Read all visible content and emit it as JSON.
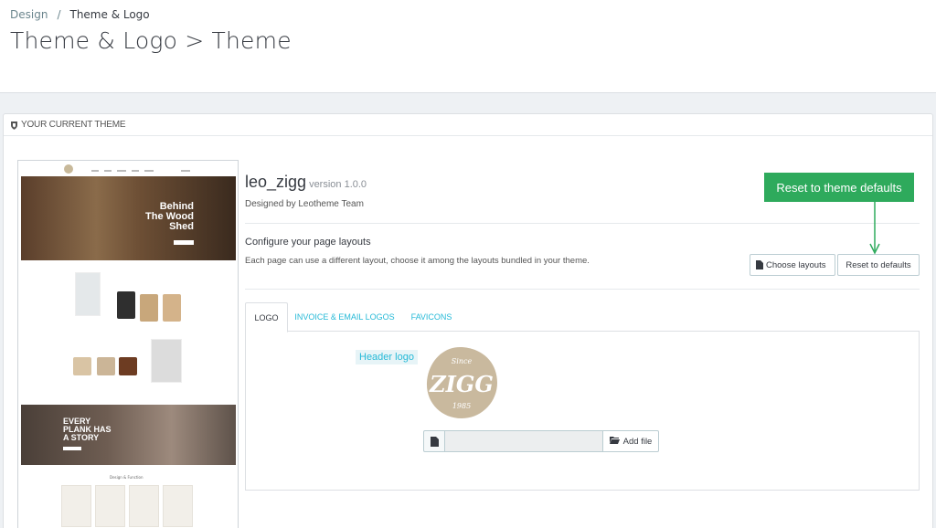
{
  "breadcrumb": {
    "parent": "Design",
    "separator": "/",
    "current": "Theme & Logo"
  },
  "page_title": "Theme & Logo > Theme",
  "panel": {
    "heading": "Your current theme",
    "icon": "shield-icon"
  },
  "preview": {
    "hero1_line1": "Behind",
    "hero1_line2": "The Wood",
    "hero1_line3": "Shed",
    "hero2_line1": "EVERY",
    "hero2_line2": "PLANK HAS",
    "hero2_line3": "A STORY",
    "caption": "Design & Function"
  },
  "theme": {
    "name": "leo_zigg",
    "version": "version 1.0.0",
    "designer": "Designed by Leotheme Team"
  },
  "layouts": {
    "title": "Configure your page layouts",
    "description": "Each page can use a different layout, choose it among the layouts bundled in your theme."
  },
  "buttons": {
    "choose_layouts": "Choose layouts",
    "reset_defaults": "Reset to defaults",
    "add_file": "Add file"
  },
  "tooltip": "Reset to theme defaults",
  "tabs": [
    {
      "label": "Logo",
      "active": true
    },
    {
      "label": "Invoice & Email logos",
      "active": false
    },
    {
      "label": "Favicons",
      "active": false
    }
  ],
  "logo_section": {
    "label": "Header logo",
    "logo_top_text": "Since",
    "logo_main_text": "ZIGG",
    "logo_bottom_text": "1985"
  },
  "colors": {
    "accent": "#25b9d7",
    "tooltip_bg": "#2eaa5c",
    "text": "#363a41"
  }
}
